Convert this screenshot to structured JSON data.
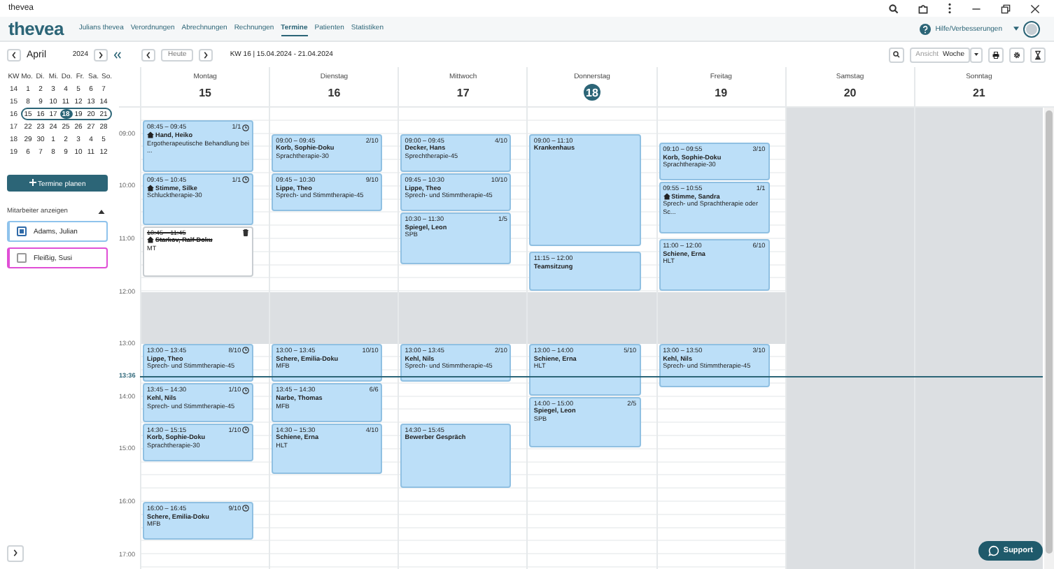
{
  "window": {
    "title": "thevea"
  },
  "app": {
    "logo": "thevea",
    "nav": [
      {
        "label": "Julians thevea",
        "selected": false
      },
      {
        "label": "Verordnungen",
        "selected": false
      },
      {
        "label": "Abrechnungen",
        "selected": false
      },
      {
        "label": "Rechnungen",
        "selected": false
      },
      {
        "label": "Termine",
        "selected": true
      },
      {
        "label": "Patienten",
        "selected": false
      },
      {
        "label": "Statistiken",
        "selected": false
      }
    ],
    "help": "Hilfe/Verbesserungen"
  },
  "toolbar": {
    "month": "April",
    "year": "2024",
    "today": "Heute",
    "week_range": "KW 16 | 15.04.2024 - 21.04.2024",
    "view_label": "Ansicht",
    "view": "Woche"
  },
  "mini_calendar": {
    "headers": [
      "KW",
      "Mo.",
      "Di.",
      "Mi.",
      "Do.",
      "Fr.",
      "Sa.",
      "So."
    ],
    "weeks": [
      {
        "week": "14",
        "selected": false,
        "days": [
          {
            "day": "1",
            "selected": false
          },
          {
            "day": "2",
            "selected": false
          },
          {
            "day": "3",
            "selected": false
          },
          {
            "day": "4",
            "selected": false
          },
          {
            "day": "5",
            "selected": false
          },
          {
            "day": "6",
            "selected": false
          },
          {
            "day": "7",
            "selected": false
          }
        ]
      },
      {
        "week": "15",
        "selected": false,
        "days": [
          {
            "day": "8",
            "selected": false
          },
          {
            "day": "9",
            "selected": false
          },
          {
            "day": "10",
            "selected": false
          },
          {
            "day": "11",
            "selected": false
          },
          {
            "day": "12",
            "selected": false
          },
          {
            "day": "13",
            "selected": false
          },
          {
            "day": "14",
            "selected": false
          }
        ]
      },
      {
        "week": "16",
        "selected": true,
        "days": [
          {
            "day": "15",
            "selected": false
          },
          {
            "day": "16",
            "selected": false
          },
          {
            "day": "17",
            "selected": false
          },
          {
            "day": "18",
            "selected": true
          },
          {
            "day": "19",
            "selected": false
          },
          {
            "day": "20",
            "selected": false
          },
          {
            "day": "21",
            "selected": false
          }
        ]
      },
      {
        "week": "17",
        "selected": false,
        "days": [
          {
            "day": "22",
            "selected": false
          },
          {
            "day": "23",
            "selected": false
          },
          {
            "day": "24",
            "selected": false
          },
          {
            "day": "25",
            "selected": false
          },
          {
            "day": "26",
            "selected": false
          },
          {
            "day": "27",
            "selected": false
          },
          {
            "day": "28",
            "selected": false
          }
        ]
      },
      {
        "week": "18",
        "selected": false,
        "days": [
          {
            "day": "29",
            "selected": false
          },
          {
            "day": "30",
            "selected": false
          },
          {
            "day": "1",
            "selected": false
          },
          {
            "day": "2",
            "selected": false
          },
          {
            "day": "3",
            "selected": false
          },
          {
            "day": "4",
            "selected": false
          },
          {
            "day": "5",
            "selected": false
          }
        ]
      },
      {
        "week": "19",
        "selected": false,
        "days": [
          {
            "day": "6",
            "selected": false
          },
          {
            "day": "7",
            "selected": false
          },
          {
            "day": "8",
            "selected": false
          },
          {
            "day": "9",
            "selected": false
          },
          {
            "day": "10",
            "selected": false
          },
          {
            "day": "11",
            "selected": false
          },
          {
            "day": "12",
            "selected": false
          }
        ]
      }
    ]
  },
  "plan_button": "Termine planen",
  "employees": {
    "title": "Mitarbeiter anzeigen",
    "expanded": true,
    "items": [
      {
        "name": "Adams, Julian",
        "checked": true,
        "color": "#8fc3ec"
      },
      {
        "name": "Fleißig, Susi",
        "checked": false,
        "color": "#e04fd6"
      }
    ]
  },
  "hours": [
    "09:00",
    "10:00",
    "11:00",
    "12:00",
    "13:00",
    "14:00",
    "15:00",
    "16:00",
    "17:00"
  ],
  "now": "13:36",
  "days": [
    {
      "name": "Montag",
      "date": "15",
      "today": false,
      "closed": false,
      "events": [
        {
          "time": "08:45 – 09:45",
          "count": "1/1",
          "title": "Hand, Heiko",
          "detail": "Ergotherapeutische Behandlung bei ...",
          "home_visit": true,
          "recurring": true,
          "cancelled": false
        },
        {
          "time": "09:45 – 10:45",
          "count": "1/1",
          "title": "Stimme, Silke",
          "detail": "Schlucktherapie-30",
          "home_visit": true,
          "recurring": true,
          "cancelled": false
        },
        {
          "time": "10:45 – 11:45",
          "title": "Starkov, Ralf-Doku",
          "detail": "MT",
          "home_visit": true,
          "recurring": false,
          "cancelled": true
        },
        {
          "time": "13:00 – 13:45",
          "count": "8/10",
          "title": "Lippe, Theo",
          "detail": "Sprech- und Stimmtherapie-45",
          "home_visit": false,
          "recurring": true,
          "cancelled": false
        },
        {
          "time": "13:45 – 14:30",
          "count": "1/10",
          "title": "Kehl, Nils",
          "detail": "Sprech- und Stimmtherapie-45",
          "home_visit": false,
          "recurring": true,
          "cancelled": false
        },
        {
          "time": "14:30 – 15:15",
          "count": "1/10",
          "title": "Korb, Sophie-Doku",
          "detail": "Sprachtherapie-30",
          "home_visit": false,
          "recurring": true,
          "cancelled": false
        },
        {
          "time": "16:00 – 16:45",
          "count": "9/10",
          "title": "Schere, Emilia-Doku",
          "detail": "MFB",
          "home_visit": false,
          "recurring": true,
          "cancelled": false
        }
      ]
    },
    {
      "name": "Dienstag",
      "date": "16",
      "today": false,
      "closed": false,
      "events": [
        {
          "time": "09:00 – 09:45",
          "count": "2/10",
          "title": "Korb, Sophie-Doku",
          "detail": "Sprachtherapie-30",
          "home_visit": false,
          "recurring": false,
          "cancelled": false
        },
        {
          "time": "09:45 – 10:30",
          "count": "9/10",
          "title": "Lippe, Theo",
          "detail": "Sprech- und Stimmtherapie-45",
          "home_visit": false,
          "recurring": false,
          "cancelled": false
        },
        {
          "time": "13:00 – 13:45",
          "count": "10/10",
          "title": "Schere, Emilia-Doku",
          "detail": "MFB",
          "home_visit": false,
          "recurring": false,
          "cancelled": false
        },
        {
          "time": "13:45 – 14:30",
          "count": "6/6",
          "title": "Narbe, Thomas",
          "detail": "MFB",
          "home_visit": false,
          "recurring": false,
          "cancelled": false
        },
        {
          "time": "14:30 – 15:30",
          "count": "4/10",
          "title": "Schiene, Erna",
          "detail": "HLT",
          "home_visit": false,
          "recurring": false,
          "cancelled": false
        }
      ]
    },
    {
      "name": "Mittwoch",
      "date": "17",
      "today": false,
      "closed": false,
      "events": [
        {
          "time": "09:00 – 09:45",
          "count": "4/10",
          "title": "Decker, Hans",
          "detail": "Sprechtherapie-45",
          "home_visit": false,
          "recurring": false,
          "cancelled": false
        },
        {
          "time": "09:45 – 10:30",
          "count": "10/10",
          "title": "Lippe, Theo",
          "detail": "Sprech- und Stimmtherapie-45",
          "home_visit": false,
          "recurring": false,
          "cancelled": false
        },
        {
          "time": "10:30 – 11:30",
          "count": "1/5",
          "title": "Spiegel, Leon",
          "detail": "SPB",
          "home_visit": false,
          "recurring": false,
          "cancelled": false
        },
        {
          "time": "13:00 – 13:45",
          "count": "2/10",
          "title": "Kehl, Nils",
          "detail": "Sprech- und Stimmtherapie-45",
          "home_visit": false,
          "recurring": false,
          "cancelled": false
        },
        {
          "time": "14:30 – 15:45",
          "title": "Bewerber Gespräch",
          "home_visit": false,
          "recurring": false,
          "cancelled": false
        }
      ]
    },
    {
      "name": "Donnerstag",
      "date": "18",
      "today": true,
      "closed": false,
      "events": [
        {
          "time": "09:00 – 11:10",
          "title": "Krankenhaus",
          "home_visit": false,
          "recurring": false,
          "cancelled": false
        },
        {
          "time": "11:15 – 12:00",
          "title": "Teamsitzung",
          "home_visit": false,
          "recurring": false,
          "cancelled": false
        },
        {
          "time": "13:00 – 14:00",
          "count": "5/10",
          "title": "Schiene, Erna",
          "detail": "HLT",
          "home_visit": false,
          "recurring": false,
          "cancelled": false
        },
        {
          "time": "14:00 – 15:00",
          "count": "2/5",
          "title": "Spiegel, Leon",
          "detail": "SPB",
          "home_visit": false,
          "recurring": false,
          "cancelled": false
        }
      ]
    },
    {
      "name": "Freitag",
      "date": "19",
      "today": false,
      "closed": false,
      "events": [
        {
          "time": "09:10 – 09:55",
          "count": "3/10",
          "title": "Korb, Sophie-Doku",
          "detail": "Sprachtherapie-30",
          "home_visit": false,
          "recurring": false,
          "cancelled": false
        },
        {
          "time": "09:55 – 10:55",
          "count": "1/1",
          "title": "Stimme, Sandra",
          "detail": "Sprech- und Sprachtherapie oder Sc...",
          "home_visit": true,
          "recurring": false,
          "cancelled": false
        },
        {
          "time": "11:00 – 12:00",
          "count": "6/10",
          "title": "Schiene, Erna",
          "detail": "HLT",
          "home_visit": false,
          "recurring": false,
          "cancelled": false
        },
        {
          "time": "13:00 – 13:50",
          "count": "3/10",
          "title": "Kehl, Nils",
          "detail": "Sprech- und Stimmtherapie-45",
          "home_visit": false,
          "recurring": false,
          "cancelled": false
        }
      ]
    },
    {
      "name": "Samstag",
      "date": "20",
      "today": false,
      "closed": true
    },
    {
      "name": "Sonntag",
      "date": "21",
      "today": false,
      "closed": true
    }
  ],
  "support": "Support"
}
